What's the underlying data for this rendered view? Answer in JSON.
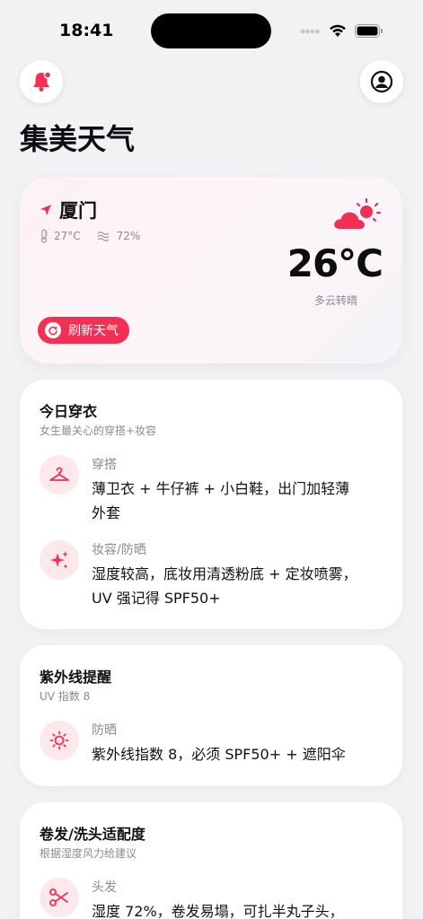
{
  "status": {
    "time": "18:41"
  },
  "app": {
    "title": "集美天气"
  },
  "weather": {
    "city": "厦门",
    "temp_small": "27°C",
    "humidity": "72%",
    "temperature": "26°C",
    "condition": "多云转晴",
    "refresh_label": "刷新天气"
  },
  "outfit": {
    "title": "今日穿衣",
    "subtitle": "女生最关心的穿搭+妆容",
    "items": [
      {
        "label": "穿搭",
        "text": "薄卫衣 + 牛仔裤 + 小白鞋，出门加轻薄外套",
        "icon": "hanger-icon"
      },
      {
        "label": "妆容/防晒",
        "text": "湿度较高，底妆用清透粉底 + 定妆喷雾，UV 强记得 SPF50+",
        "icon": "sparkle-icon"
      }
    ]
  },
  "uv": {
    "title": "紫外线提醒",
    "subtitle": "UV 指数 8",
    "items": [
      {
        "label": "防晒",
        "text": "紫外线指数 8，必须 SPF50+ + 遮阳伞",
        "icon": "sun-icon"
      }
    ]
  },
  "hair": {
    "title": "卷发/洗头适配度",
    "subtitle": "根据湿度风力给建议",
    "items": [
      {
        "label": "头发",
        "text": "湿度 72%，卷发易塌，可扎半丸子头，",
        "icon": "scissors-icon"
      }
    ]
  },
  "colors": {
    "accent": "#f22f55",
    "accent_light": "#fde8ec"
  }
}
